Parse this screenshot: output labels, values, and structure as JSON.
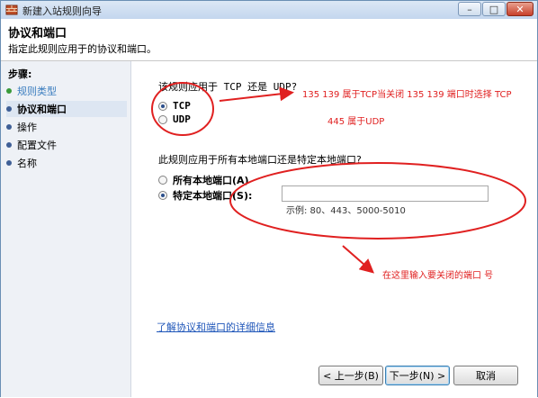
{
  "window": {
    "title": "新建入站规则向导",
    "minimize": "–",
    "maximize": "□",
    "close": "✕"
  },
  "header": {
    "title": "协议和端口",
    "subtitle": "指定此规则应用于的协议和端口。"
  },
  "sidebar": {
    "title": "步骤:",
    "items": [
      {
        "label": "规则类型",
        "state": "done"
      },
      {
        "label": "协议和端口",
        "state": "active"
      },
      {
        "label": "操作",
        "state": "pending"
      },
      {
        "label": "配置文件",
        "state": "pending"
      },
      {
        "label": "名称",
        "state": "pending"
      }
    ]
  },
  "protocol": {
    "question": "该规则应用于 TCP 还是 UDP?",
    "options": [
      {
        "label": "TCP",
        "selected": true
      },
      {
        "label": "UDP",
        "selected": false
      }
    ]
  },
  "ports": {
    "question": "此规则应用于所有本地端口还是特定本地端口?",
    "all_label": "所有本地端口(A)",
    "specific_label": "特定本地端口(S):",
    "selected": "specific",
    "value": "",
    "example": "示例: 80、443、5000-5010"
  },
  "link_text": "了解协议和端口的详细信息",
  "buttons": {
    "back": "< 上一步(B)",
    "next": "下一步(N) >",
    "cancel": "取消"
  },
  "annotations": {
    "note1": "135 139 属于TCP当关闭 135 139 端口时选择 TCP",
    "note2": "445 属于UDP",
    "note3": "在这里输入要关闭的端口 号"
  },
  "colors": {
    "annotation": "#e02020",
    "link": "#1f56b9",
    "sidebar_bg": "#eef1f6"
  }
}
